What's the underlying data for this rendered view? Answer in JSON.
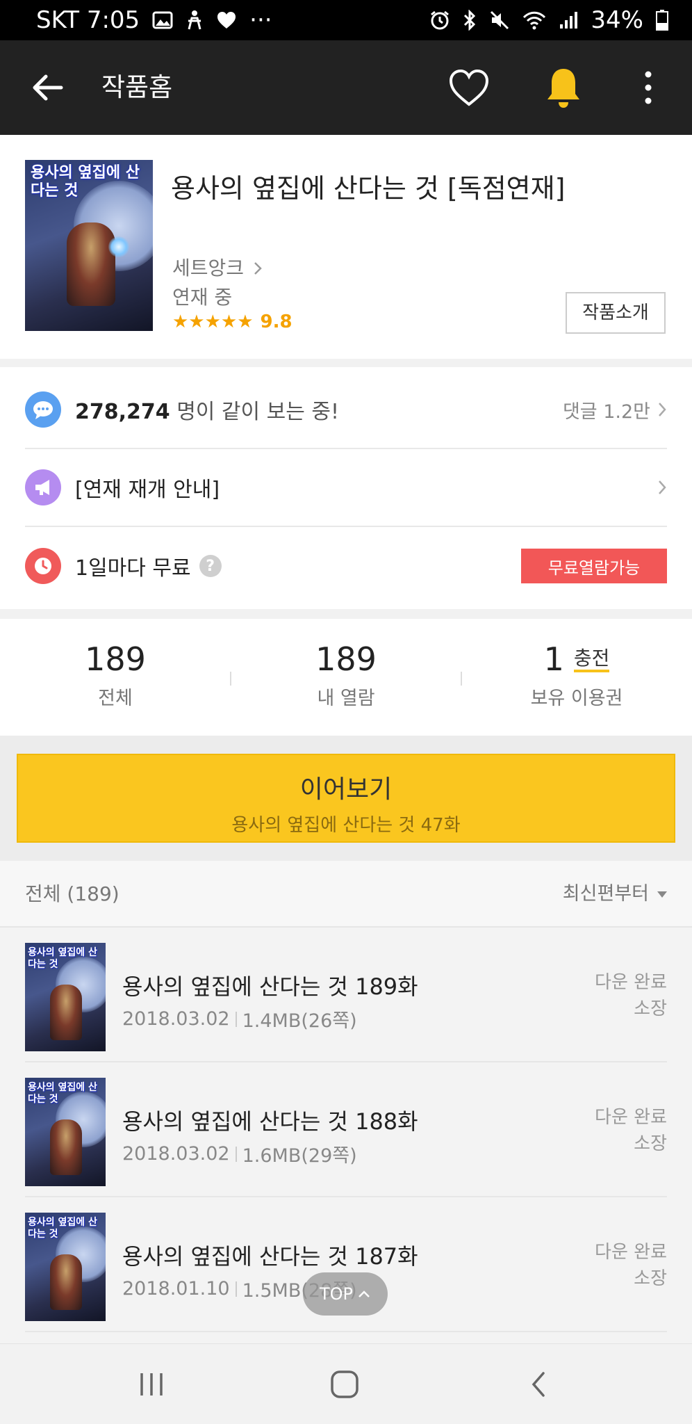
{
  "status_bar": {
    "carrier_time": "SKT 7:05",
    "more": "···",
    "battery": "34%"
  },
  "app_bar": {
    "title": "작품홈"
  },
  "book": {
    "cover_text": "용사의 옆집에 산다는 것",
    "title": "용사의 옆집에 산다는 것 [독점연재]",
    "author": "세트앙크",
    "status": "연재 중",
    "stars": "★★★★★",
    "score": "9.8",
    "intro_button": "작품소개"
  },
  "info": {
    "viewers_count": "278,274",
    "viewers_text": "명이 같이 보는 중!",
    "comments": "댓글 1.2만",
    "notice": "[연재 재개 안내]",
    "free_every": "1일마다 무료",
    "help": "?",
    "free_badge": "무료열람가능"
  },
  "stats": {
    "total_num": "189",
    "total_label": "전체",
    "read_num": "189",
    "read_label": "내 열람",
    "tickets_num": "1",
    "charge_label": "충전",
    "tickets_label": "보유 이용권"
  },
  "continue": {
    "label": "이어보기",
    "episode": "용사의 옆집에 산다는 것 47화"
  },
  "list": {
    "count_label": "전체 (189)",
    "sort_label": "최신편부터",
    "episodes": [
      {
        "title": "용사의 옆집에 산다는 것 189화",
        "date": "2018.03.02",
        "size": "1.4MB(26쪽)",
        "state1": "다운 완료",
        "state2": "소장"
      },
      {
        "title": "용사의 옆집에 산다는 것 188화",
        "date": "2018.03.02",
        "size": "1.6MB(29쪽)",
        "state1": "다운 완료",
        "state2": "소장"
      },
      {
        "title": "용사의 옆집에 산다는 것 187화",
        "date": "2018.01.10",
        "size": "1.5MB(28쪽)",
        "state1": "다운 완료",
        "state2": "소장"
      }
    ]
  },
  "top_button": "TOP",
  "colors": {
    "accent_yellow": "#fac61f",
    "bell_yellow": "#f7c21a",
    "free_red": "#f25757",
    "rating_orange": "#f5a200",
    "chat_blue": "#5aa0f0",
    "notice_purple": "#b58cf0",
    "clock_red": "#f05a5a"
  },
  "icons": [
    "image-icon",
    "accessibility-icon",
    "heart-status-icon",
    "alarm-icon",
    "bluetooth-icon",
    "mute-icon",
    "wifi-icon",
    "signal-icon",
    "battery-icon",
    "back-arrow-icon",
    "heart-icon",
    "bell-icon",
    "more-vert-icon",
    "chevron-right-icon",
    "chat-icon",
    "megaphone-icon",
    "clock-icon",
    "help-icon",
    "sort-triangle-icon",
    "chevron-up-icon",
    "recent-apps-icon",
    "home-icon",
    "back-nav-icon"
  ]
}
